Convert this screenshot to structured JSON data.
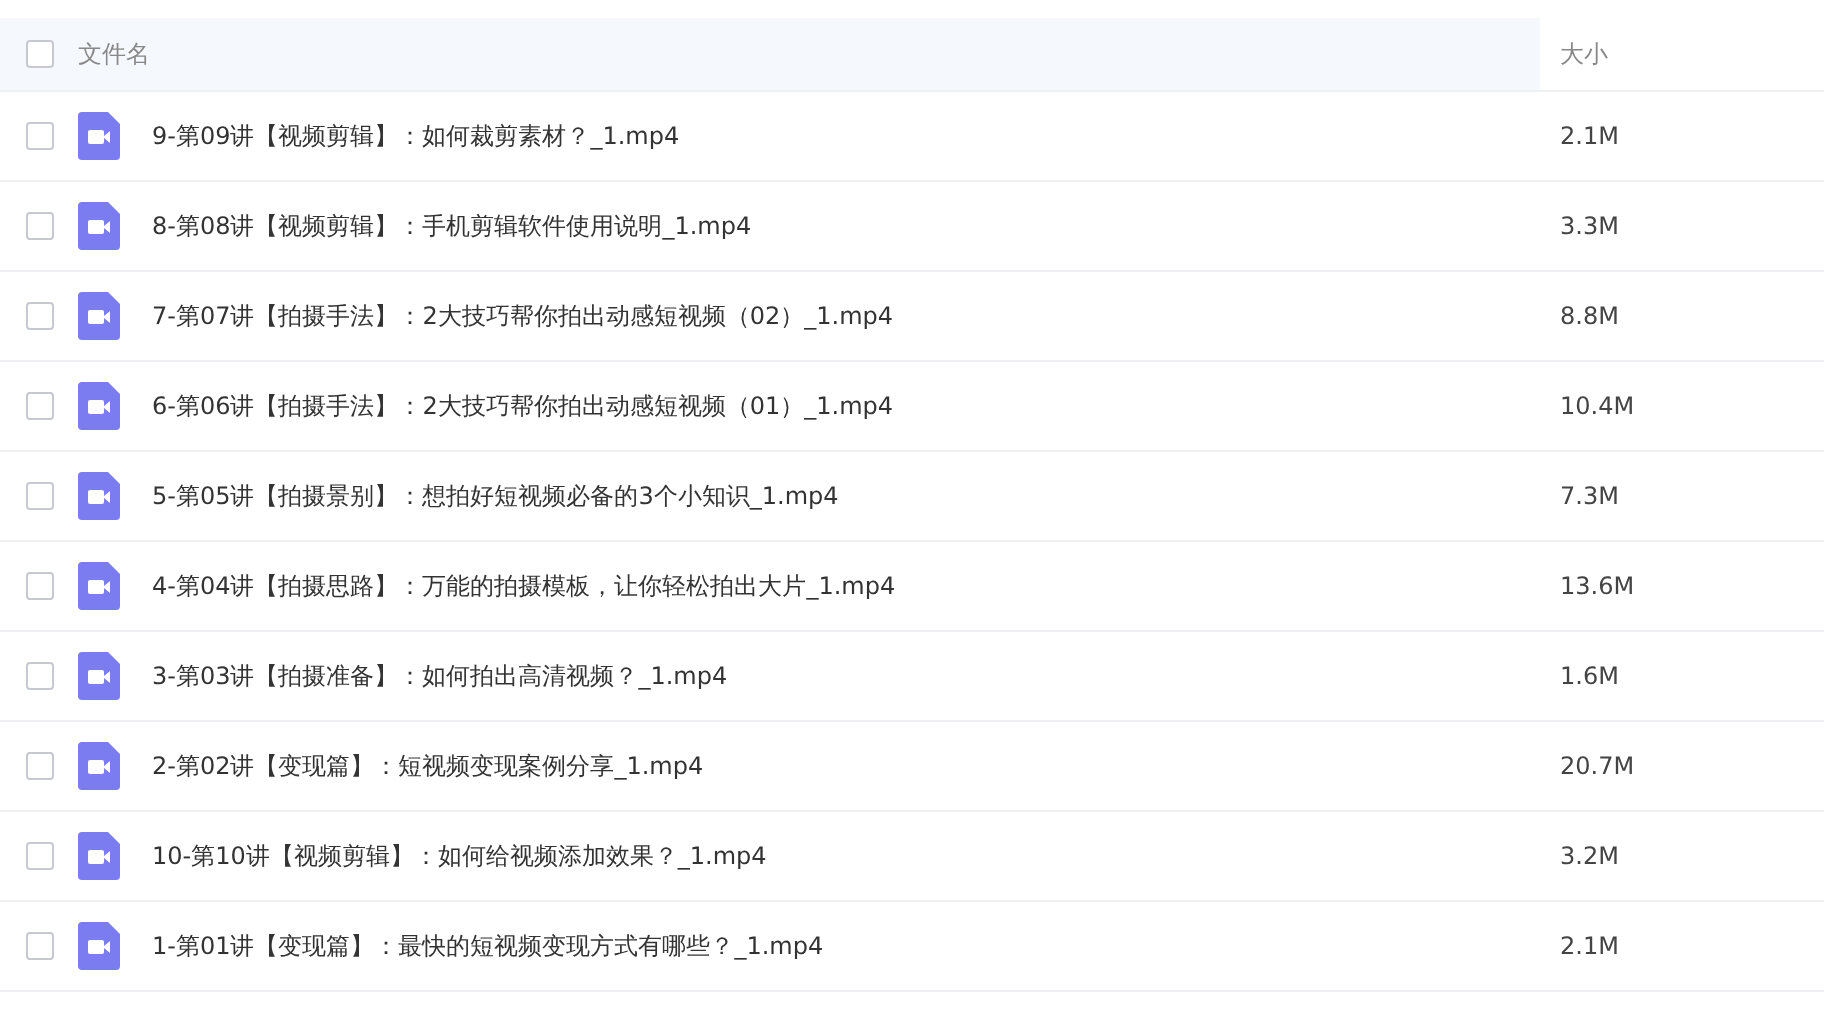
{
  "table": {
    "header": {
      "checked": false,
      "columns": [
        "文件名",
        "大小"
      ]
    },
    "rows": [
      {
        "checked": false,
        "name": "9-第09讲【视频剪辑】：如何裁剪素材？_1.mp4",
        "size": "2.1M"
      },
      {
        "checked": false,
        "name": "8-第08讲【视频剪辑】：手机剪辑软件使用说明_1.mp4",
        "size": "3.3M"
      },
      {
        "checked": false,
        "name": "7-第07讲【拍摄手法】：2大技巧帮你拍出动感短视频（02）_1.mp4",
        "size": "8.8M"
      },
      {
        "checked": false,
        "name": "6-第06讲【拍摄手法】：2大技巧帮你拍出动感短视频（01）_1.mp4",
        "size": "10.4M"
      },
      {
        "checked": false,
        "name": "5-第05讲【拍摄景别】：想拍好短视频必备的3个小知识_1.mp4",
        "size": "7.3M"
      },
      {
        "checked": false,
        "name": "4-第04讲【拍摄思路】：万能的拍摄模板，让你轻松拍出大片_1.mp4",
        "size": "13.6M"
      },
      {
        "checked": false,
        "name": "3-第03讲【拍摄准备】：如何拍出高清视频？_1.mp4",
        "size": "1.6M"
      },
      {
        "checked": false,
        "name": "2-第02讲【变现篇】：短视频变现案例分享_1.mp4",
        "size": "20.7M"
      },
      {
        "checked": false,
        "name": "10-第10讲【视频剪辑】：如何给视频添加效果？_1.mp4",
        "size": "3.2M"
      },
      {
        "checked": false,
        "name": "1-第01讲【变现篇】：最快的短视频变现方式有哪些？_1.mp4",
        "size": "2.1M"
      }
    ]
  }
}
